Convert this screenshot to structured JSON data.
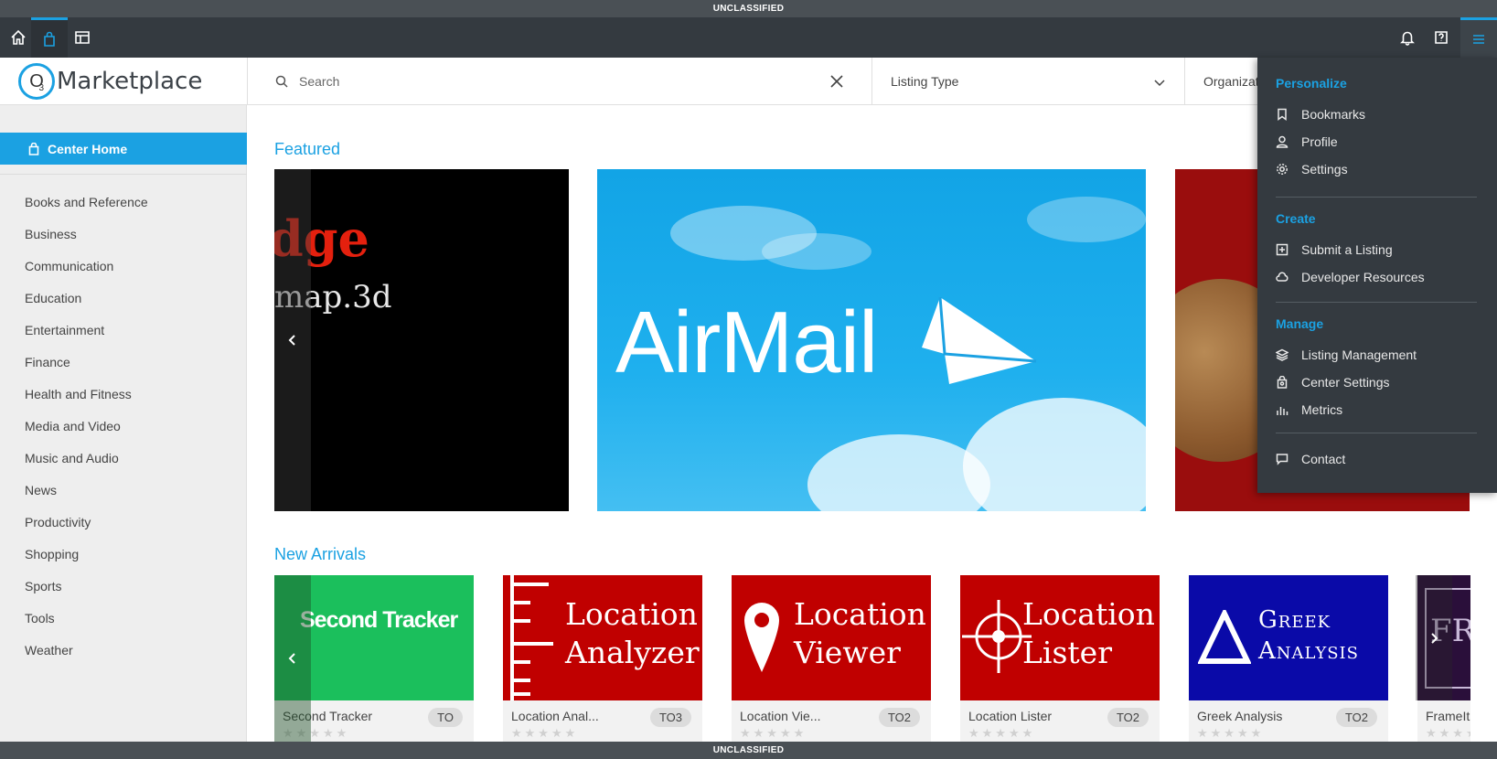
{
  "classification": {
    "top": "UNCLASSIFIED",
    "bottom": "UNCLASSIFIED"
  },
  "topnav": {
    "icons": [
      "home-icon",
      "bag-icon",
      "layout-icon",
      "bell-icon",
      "help-icon",
      "menu-icon"
    ]
  },
  "header": {
    "logo_letter": "O",
    "logo_sub": "3",
    "logo_text": "Marketplace",
    "search_placeholder": "Search",
    "listing_type": "Listing Type",
    "organization": "Organizat"
  },
  "sidebar": {
    "center_home": "Center Home",
    "categories": [
      "Books and Reference",
      "Business",
      "Communication",
      "Education",
      "Entertainment",
      "Finance",
      "Health and Fitness",
      "Media and Video",
      "Music and Audio",
      "News",
      "Productivity",
      "Shopping",
      "Sports",
      "Tools",
      "Weather"
    ]
  },
  "main": {
    "featured_title": "Featured",
    "new_arrivals_title": "New Arrivals",
    "featured": [
      {
        "line1": "dge",
        "line2": "map.3d"
      },
      {
        "title": "AirMail"
      },
      {
        "title": ""
      }
    ],
    "new_arrivals": [
      {
        "banner": "Second Tracker",
        "name": "Second Tracker",
        "badge": "TO",
        "color": "#1bbf5c"
      },
      {
        "banner_l1": "Location",
        "banner_l2": "Analyzer",
        "name": "Location Anal...",
        "badge": "TO3",
        "color": "#c00000"
      },
      {
        "banner_l1": "Location",
        "banner_l2": "Viewer",
        "name": "Location Vie...",
        "badge": "TO2",
        "color": "#c00000"
      },
      {
        "banner_l1": "Location",
        "banner_l2": "Lister",
        "name": "Location Lister",
        "badge": "TO2",
        "color": "#c00000"
      },
      {
        "banner_l1": "Greek",
        "banner_l2": "Analysis",
        "name": "Greek Analysis",
        "badge": "TO2",
        "color": "#0a0aa8"
      },
      {
        "banner": "FR",
        "name": "FrameIt",
        "badge": "",
        "color": "#2a0f3a"
      }
    ],
    "stars": "★★★★★"
  },
  "dropdown": {
    "personalize": "Personalize",
    "bookmarks": "Bookmarks",
    "profile": "Profile",
    "settings": "Settings",
    "create": "Create",
    "submit_listing": "Submit a Listing",
    "developer_resources": "Developer Resources",
    "manage": "Manage",
    "listing_management": "Listing Management",
    "center_settings": "Center Settings",
    "metrics": "Metrics",
    "contact": "Contact"
  },
  "colors": {
    "accent": "#1ba1e2",
    "nav_bg": "#343a40",
    "class_bar": "#4a5055"
  }
}
